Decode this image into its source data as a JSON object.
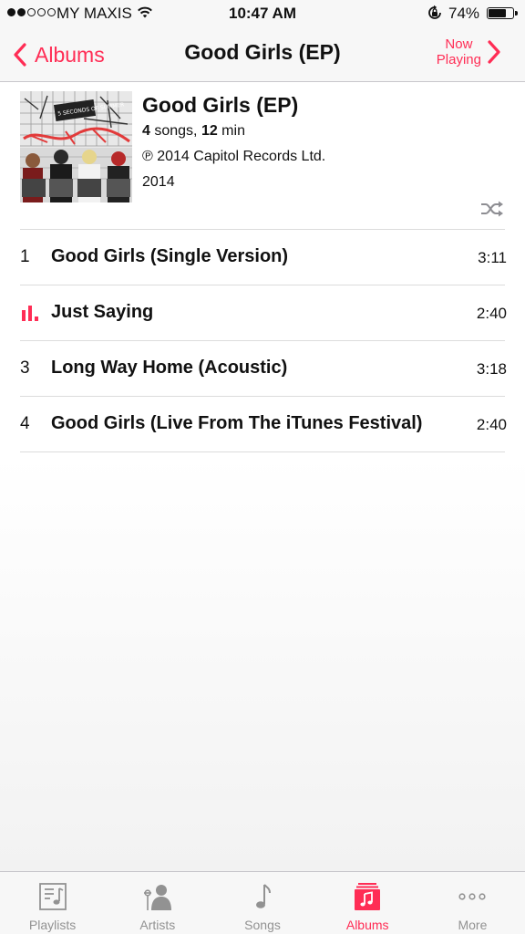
{
  "status": {
    "carrier": "MY MAXIS",
    "time": "10:47 AM",
    "battery": "74%",
    "battery_level": 0.74,
    "signal_bars": 2,
    "signal_total": 5
  },
  "nav": {
    "back_label": "Albums",
    "title": "Good Girls (EP)",
    "now_playing_line1": "Now",
    "now_playing_line2": "Playing"
  },
  "album": {
    "title": "Good Girls (EP)",
    "song_count": "4",
    "songs_word": " songs, ",
    "duration": "12",
    "minutes_word": " min",
    "label": "℗ 2014 Capitol Records Ltd.",
    "year": "2014",
    "cover_text": "5 SECONDS OF SUMMER"
  },
  "tracks": [
    {
      "number": "1",
      "title": "Good Girls (Single Version)",
      "duration": "3:11",
      "playing": false
    },
    {
      "number": "",
      "title": "Just Saying",
      "duration": "2:40",
      "playing": true
    },
    {
      "number": "3",
      "title": "Long Way Home (Acoustic)",
      "duration": "3:18",
      "playing": false
    },
    {
      "number": "4",
      "title": "Good Girls (Live From The iTunes Festival)",
      "duration": "2:40",
      "playing": false
    }
  ],
  "tabs": [
    {
      "label": "Playlists",
      "icon": "playlists-icon",
      "active": false
    },
    {
      "label": "Artists",
      "icon": "artists-icon",
      "active": false
    },
    {
      "label": "Songs",
      "icon": "songs-icon",
      "active": false
    },
    {
      "label": "Albums",
      "icon": "albums-icon",
      "active": true
    },
    {
      "label": "More",
      "icon": "more-icon",
      "active": false
    }
  ],
  "colors": {
    "accent": "#ff2d55",
    "inactive_tab": "#929292",
    "separator": "#dcdcdc"
  }
}
